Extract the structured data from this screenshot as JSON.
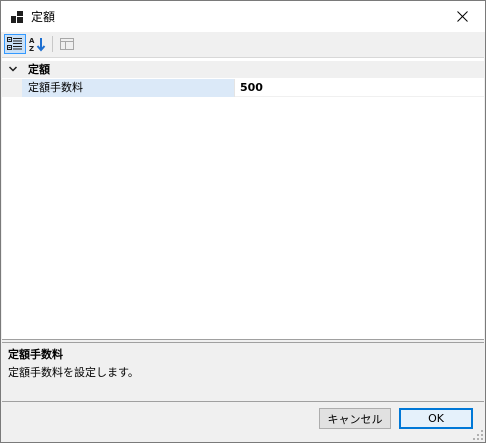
{
  "window": {
    "title": "定額",
    "close_icon": "close-icon",
    "app_icon": "window-app-icon"
  },
  "toolbar": {
    "buttons": [
      {
        "name": "categorized-view",
        "icon": "categorized-icon",
        "active": true
      },
      {
        "name": "alphabetical-sort",
        "icon": "sort-az-icon",
        "active": false
      },
      {
        "name": "property-pages",
        "icon": "property-pages-icon",
        "active": false
      }
    ]
  },
  "grid": {
    "category": {
      "label": "定額",
      "expanded": true
    },
    "properties": [
      {
        "name": "定額手数料",
        "value": "500"
      }
    ]
  },
  "description": {
    "title": "定額手数料",
    "text": "定額手数料を設定します。"
  },
  "buttons": {
    "cancel_label": "キャンセル",
    "ok_label": "OK"
  },
  "colors": {
    "accent": "#0078d7",
    "selection": "#dbe9f8",
    "active_tool": "#c9e0f7"
  }
}
